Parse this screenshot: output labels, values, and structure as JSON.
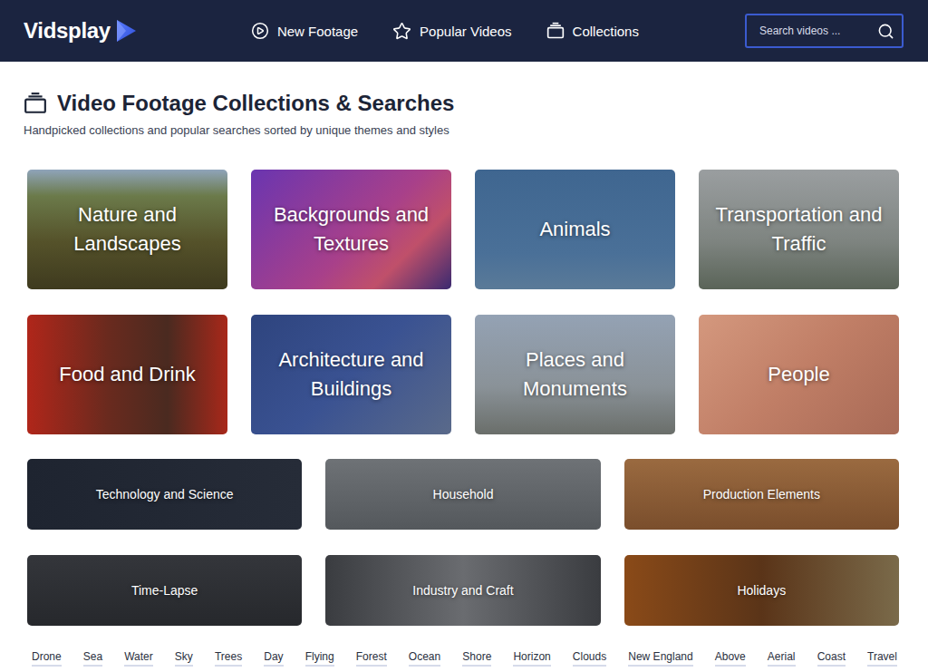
{
  "logo": {
    "text": "Vidsplay"
  },
  "nav": [
    {
      "label": "New Footage",
      "icon": "play"
    },
    {
      "label": "Popular Videos",
      "icon": "star"
    },
    {
      "label": "Collections",
      "icon": "collections"
    }
  ],
  "search": {
    "placeholder": "Search videos ..."
  },
  "page": {
    "title": "Video Footage Collections & Searches",
    "subtitle": "Handpicked collections and popular searches sorted by unique themes and styles"
  },
  "collections": [
    {
      "label": "Nature and Landscapes",
      "kind": "large"
    },
    {
      "label": "Backgrounds and Textures",
      "kind": "large"
    },
    {
      "label": "Animals",
      "kind": "large"
    },
    {
      "label": "Transportation and Traffic",
      "kind": "large"
    },
    {
      "label": "Food and Drink",
      "kind": "large"
    },
    {
      "label": "Architecture and Buildings",
      "kind": "large"
    },
    {
      "label": "Places and Monuments",
      "kind": "large"
    },
    {
      "label": "People",
      "kind": "large"
    },
    {
      "label": "Technology and Science",
      "kind": "small"
    },
    {
      "label": "Household",
      "kind": "small"
    },
    {
      "label": "Production Elements",
      "kind": "small"
    },
    {
      "label": "Time-Lapse",
      "kind": "small"
    },
    {
      "label": "Industry and Craft",
      "kind": "small"
    },
    {
      "label": "Holidays",
      "kind": "small"
    }
  ],
  "tags": [
    "Drone",
    "Sea",
    "Water",
    "Sky",
    "Trees",
    "Day",
    "Flying",
    "Forest",
    "Ocean",
    "Shore",
    "Horizon",
    "Clouds",
    "New England",
    "Above",
    "Aerial",
    "Coast",
    "Travel"
  ]
}
